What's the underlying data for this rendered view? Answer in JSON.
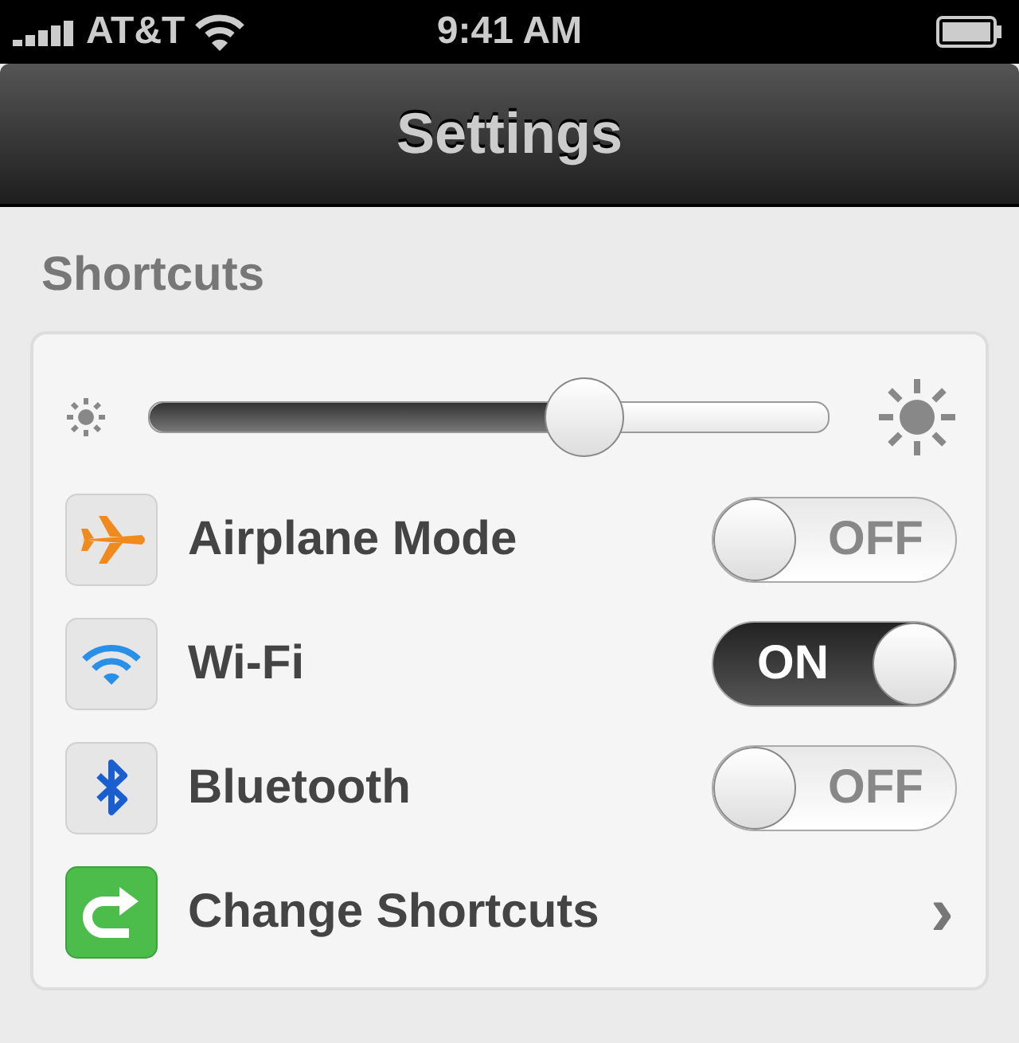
{
  "status_bar": {
    "carrier": "AT&T",
    "time": "9:41 AM"
  },
  "nav_bar": {
    "title": "Settings"
  },
  "section": {
    "header": "Shortcuts"
  },
  "brightness": {
    "level": 0.64
  },
  "rows": [
    {
      "kind": "toggle",
      "label": "Airplane Mode",
      "on": false,
      "toggle_text": "OFF"
    },
    {
      "kind": "toggle",
      "label": "Wi-Fi",
      "on": true,
      "toggle_text": "ON"
    },
    {
      "kind": "toggle",
      "label": "Bluetooth",
      "on": false,
      "toggle_text": "OFF"
    },
    {
      "kind": "link",
      "label": "Change Shortcuts",
      "chevron": "›"
    }
  ]
}
